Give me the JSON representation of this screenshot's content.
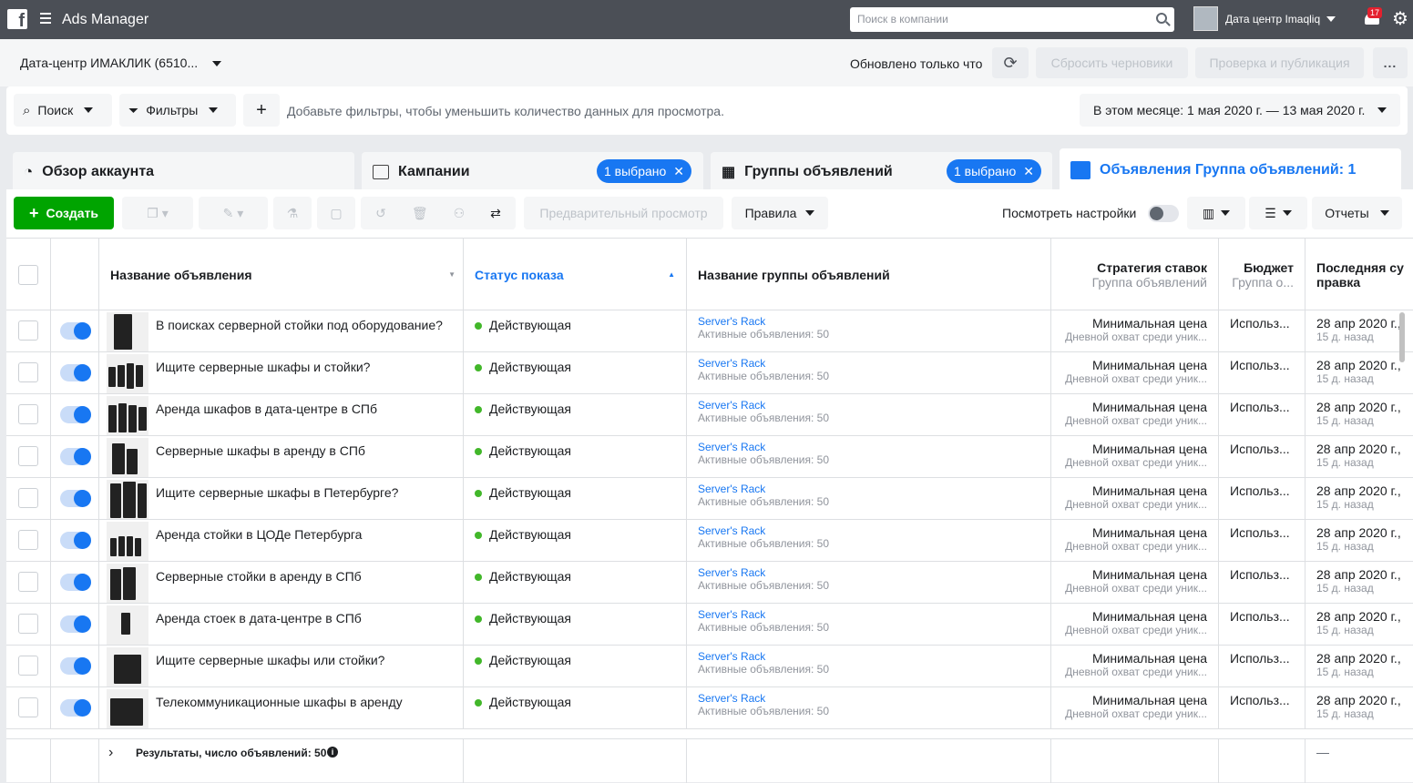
{
  "topbar": {
    "app_title": "Ads Manager",
    "search_placeholder": "Поиск в компании",
    "account_label": "Дата центр Imaqliq",
    "notification_count": "17"
  },
  "subheader": {
    "account_name": "Дата-центр ИМАКЛИК (6510...",
    "updated_text": "Обновлено только что",
    "reset_label": "Сбросить черновики",
    "publish_label": "Проверка и публикация",
    "more_label": "..."
  },
  "filters": {
    "search_label": "Поиск",
    "filters_label": "Фильтры",
    "add_label": "+",
    "hint": "Добавьте фильтры, чтобы уменьшить количество данных для просмотра.",
    "date_range": "В этом месяце: 1 мая 2020 г. — 13 мая 2020 г."
  },
  "tabs": [
    {
      "label": "Обзор аккаунта",
      "chip": ""
    },
    {
      "label": "Кампании",
      "chip": "1 выбрано"
    },
    {
      "label": "Группы объявлений",
      "chip": "1 выбрано"
    },
    {
      "label": "Объявления Группа объявлений: 1",
      "chip": ""
    }
  ],
  "toolbar": {
    "create_label": "Создать",
    "preview_label": "Предварительный просмотр",
    "rules_label": "Правила",
    "view_settings_label": "Посмотреть настройки",
    "reports_label": "Отчеты"
  },
  "columns": {
    "ad_name": "Название объявления",
    "status": "Статус показа",
    "adset_name": "Название группы объявлений",
    "bid": "Стратегия ставок",
    "bid_sub": "Группа объявлений",
    "budget": "Бюджет",
    "budget_sub": "Группа о...",
    "last_edit": "Последняя су",
    "last_edit2": "правка"
  },
  "rows": [
    {
      "name": "В поисках серверной стойки под оборудование?",
      "status": "Действующая",
      "adset": "Server's Rack",
      "adset_sub": "Активные объявления: 50",
      "bid": "Минимальная цена",
      "bid_sub": "Дневной охват среди уник...",
      "budget": "Использ...",
      "edit": "28 апр 2020 г.,",
      "edit_sub": "15 д. назад"
    },
    {
      "name": "Ищите серверные шкафы и стойки?",
      "status": "Действующая",
      "adset": "Server's Rack",
      "adset_sub": "Активные объявления: 50",
      "bid": "Минимальная цена",
      "bid_sub": "Дневной охват среди уник...",
      "budget": "Использ...",
      "edit": "28 апр 2020 г.,",
      "edit_sub": "15 д. назад"
    },
    {
      "name": "Аренда шкафов в дата-центре в СПб",
      "status": "Действующая",
      "adset": "Server's Rack",
      "adset_sub": "Активные объявления: 50",
      "bid": "Минимальная цена",
      "bid_sub": "Дневной охват среди уник...",
      "budget": "Использ...",
      "edit": "28 апр 2020 г.,",
      "edit_sub": "15 д. назад"
    },
    {
      "name": "Серверные шкафы в аренду в СПб",
      "status": "Действующая",
      "adset": "Server's Rack",
      "adset_sub": "Активные объявления: 50",
      "bid": "Минимальная цена",
      "bid_sub": "Дневной охват среди уник...",
      "budget": "Использ...",
      "edit": "28 апр 2020 г.,",
      "edit_sub": "15 д. назад"
    },
    {
      "name": "Ищите серверные шкафы в Петербурге?",
      "status": "Действующая",
      "adset": "Server's Rack",
      "adset_sub": "Активные объявления: 50",
      "bid": "Минимальная цена",
      "bid_sub": "Дневной охват среди уник...",
      "budget": "Использ...",
      "edit": "28 апр 2020 г.,",
      "edit_sub": "15 д. назад"
    },
    {
      "name": "Аренда стойки в ЦОДе Петербурга",
      "status": "Действующая",
      "adset": "Server's Rack",
      "adset_sub": "Активные объявления: 50",
      "bid": "Минимальная цена",
      "bid_sub": "Дневной охват среди уник...",
      "budget": "Использ...",
      "edit": "28 апр 2020 г.,",
      "edit_sub": "15 д. назад"
    },
    {
      "name": "Серверные стойки в аренду в СПб",
      "status": "Действующая",
      "adset": "Server's Rack",
      "adset_sub": "Активные объявления: 50",
      "bid": "Минимальная цена",
      "bid_sub": "Дневной охват среди уник...",
      "budget": "Использ...",
      "edit": "28 апр 2020 г.,",
      "edit_sub": "15 д. назад"
    },
    {
      "name": "Аренда стоек в дата-центре в СПб",
      "status": "Действующая",
      "adset": "Server's Rack",
      "adset_sub": "Активные объявления: 50",
      "bid": "Минимальная цена",
      "bid_sub": "Дневной охват среди уник...",
      "budget": "Использ...",
      "edit": "28 апр 2020 г.,",
      "edit_sub": "15 д. назад"
    },
    {
      "name": "Ищите серверные шкафы или стойки?",
      "status": "Действующая",
      "adset": "Server's Rack",
      "adset_sub": "Активные объявления: 50",
      "bid": "Минимальная цена",
      "bid_sub": "Дневной охват среди уник...",
      "budget": "Использ...",
      "edit": "28 апр 2020 г.,",
      "edit_sub": "15 д. назад"
    },
    {
      "name": "Телекоммуникационные шкафы в аренду",
      "status": "Действующая",
      "adset": "Server's Rack",
      "adset_sub": "Активные объявления: 50",
      "bid": "Минимальная цена",
      "bid_sub": "Дневной охват среди уник...",
      "budget": "Использ...",
      "edit": "28 апр 2020 г.,",
      "edit_sub": "15 д. назад"
    }
  ],
  "footer": {
    "results_label": "Результаты, число объявлений: 50",
    "edit_dash": "—"
  },
  "colors": {
    "accent": "#1877f2",
    "create": "#00a400",
    "active_dot": "#42b72a",
    "topbar": "#4b4f56"
  }
}
